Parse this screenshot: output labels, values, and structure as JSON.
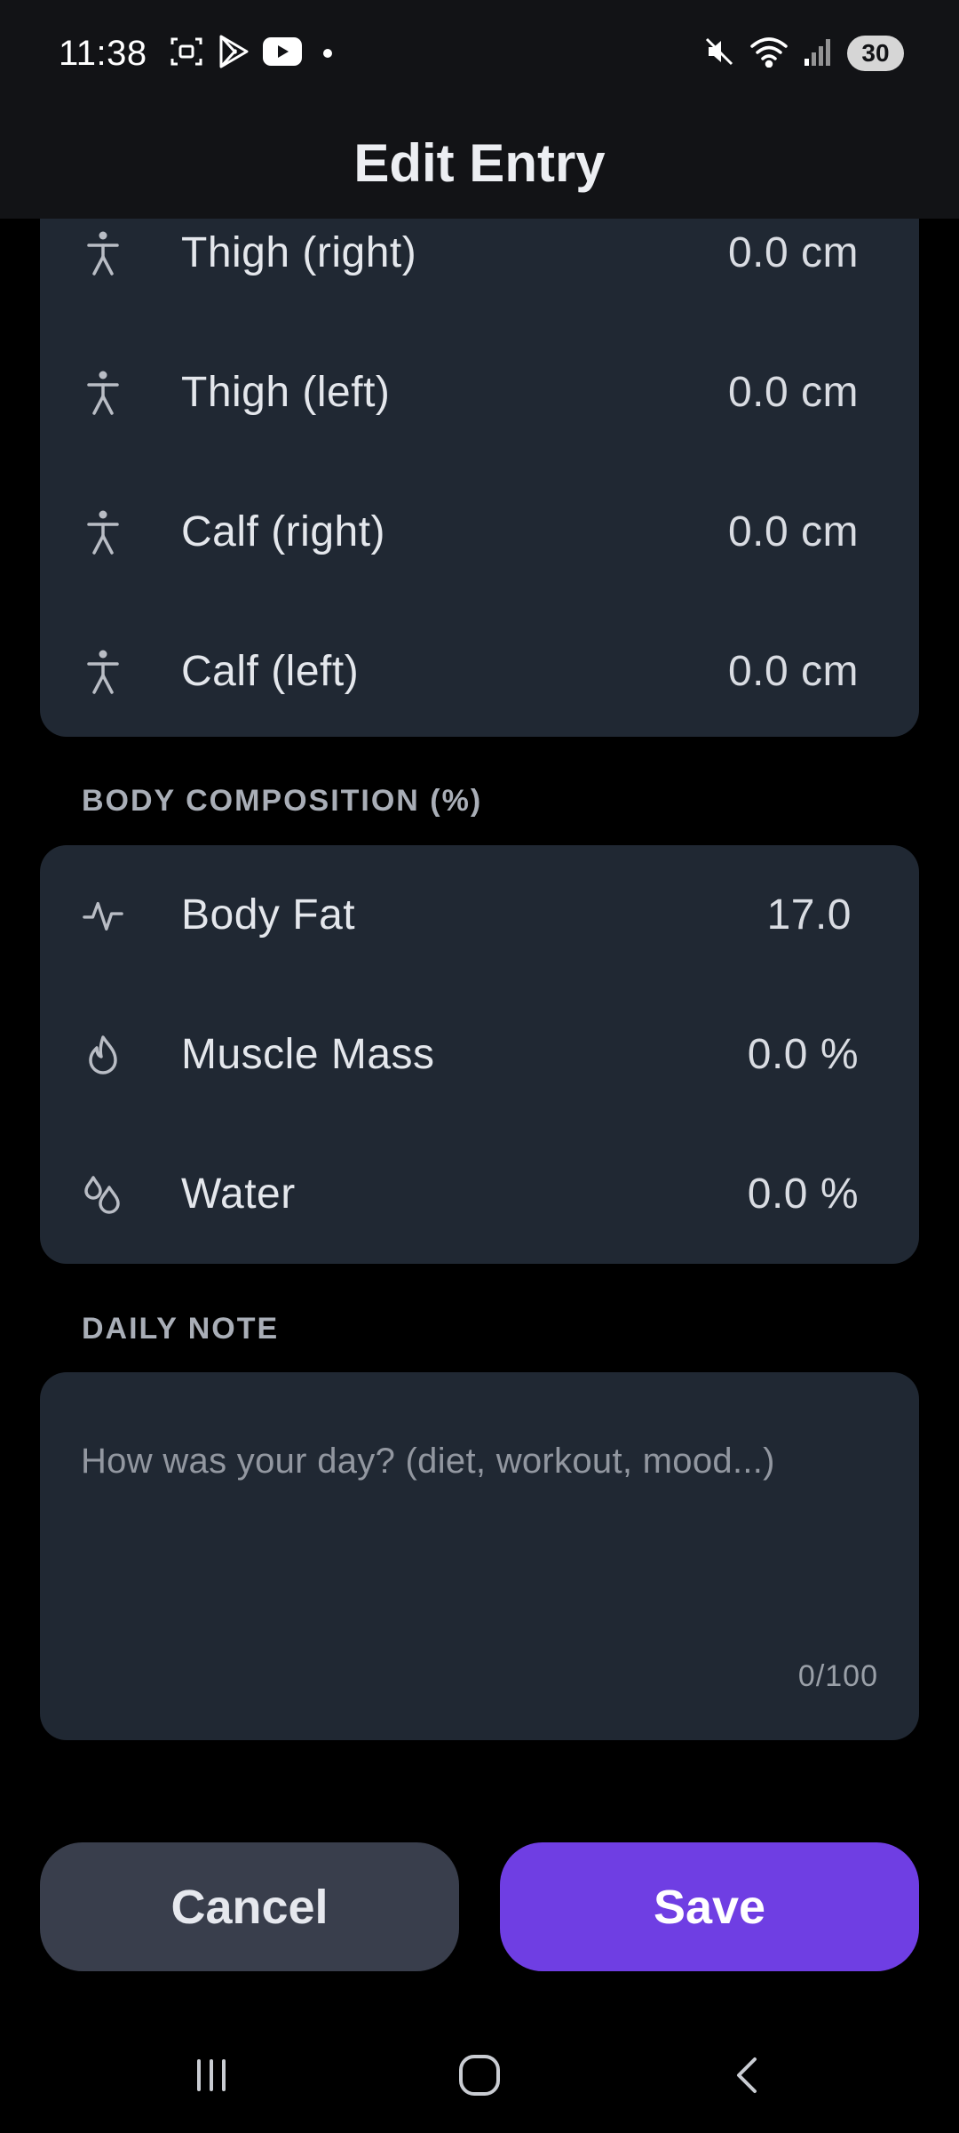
{
  "status_bar": {
    "time": "11:38",
    "left_icons": [
      "screenshot-icon",
      "play-store-icon",
      "youtube-icon",
      "notification-dot"
    ],
    "right_icons": [
      "mute-icon",
      "wifi-icon",
      "signal-icon"
    ],
    "battery": "30"
  },
  "header": {
    "title": "Edit Entry"
  },
  "measurements": [
    {
      "label": "Thigh (right)",
      "value": "0.0 cm",
      "icon": "person-icon"
    },
    {
      "label": "Thigh (left)",
      "value": "0.0 cm",
      "icon": "person-icon"
    },
    {
      "label": "Calf (right)",
      "value": "0.0 cm",
      "icon": "person-icon"
    },
    {
      "label": "Calf (left)",
      "value": "0.0 cm",
      "icon": "person-icon"
    }
  ],
  "body_composition": {
    "title": "BODY COMPOSITION (%)",
    "items": [
      {
        "label": "Body Fat",
        "value": "17.0",
        "icon": "pulse-icon"
      },
      {
        "label": "Muscle Mass",
        "value": "0.0 %",
        "icon": "flame-icon"
      },
      {
        "label": "Water",
        "value": "0.0 %",
        "icon": "water-drops-icon"
      }
    ]
  },
  "daily_note": {
    "title": "DAILY NOTE",
    "placeholder": "How was your day? (diet, workout, mood...)",
    "counter": "0/100"
  },
  "actions": {
    "cancel": "Cancel",
    "save": "Save"
  },
  "colors": {
    "background": "#000000",
    "card": "#202833",
    "header": "#121316",
    "accent": "#6f3ee3",
    "cancel_button": "#393e4c"
  }
}
